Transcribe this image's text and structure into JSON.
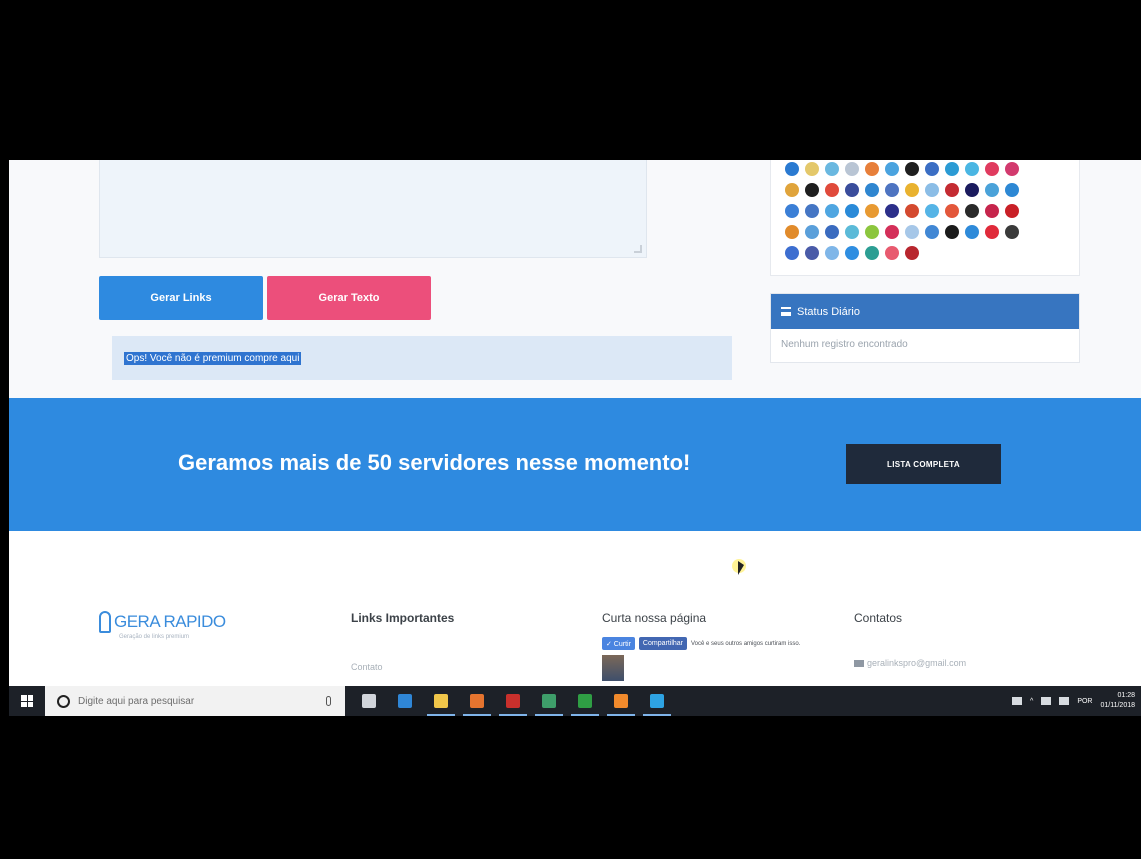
{
  "form": {
    "gerar_links_label": "Gerar Links",
    "gerar_texto_label": "Gerar Texto",
    "alert_text": "Ops! Você não é premium compre aqui"
  },
  "sidebar": {
    "status_title": "Status Diário",
    "status_empty": "Nenhum registro encontrado",
    "icon_rows": [
      [
        "#2a7ad1",
        "#e4c86a",
        "#6ab8e0",
        "#b9c5d4",
        "#e77f3a",
        "#4aa3df",
        "#1f1f1f",
        "#3b6ec4",
        "#2b9bd4",
        "#4ab6e3",
        "#e03b5f",
        "#d23a6e"
      ],
      [
        "#e0a43b",
        "#1f1f1f",
        "#e04a3b",
        "#3a4d9c",
        "#2f86d0",
        "#4e74c1",
        "#e9b22f",
        "#8bbde6",
        "#c42b32",
        "#1b1b5e",
        "#4aa2d9",
        "#2d88d4"
      ],
      [
        "#3b7fd6",
        "#4576c4",
        "#4fa6e1",
        "#2a8ad8",
        "#e89a32",
        "#2c2f8a",
        "#d44a2f",
        "#55b4e6",
        "#e3573b",
        "#2a2a2a",
        "#c6254c",
        "#c92027"
      ],
      [
        "#e18b2b",
        "#5a9fda",
        "#3a6bbf",
        "#5bbad8",
        "#8cc63e",
        "#d42f59",
        "#a6c7e8",
        "#4187d4",
        "#1b1b1b",
        "#2e8ad9",
        "#e02a3a",
        "#3a3a3a"
      ],
      [
        "#3d6ed0",
        "#4a5ba8",
        "#7fb6e8",
        "#2f8ee1",
        "#2c9e93",
        "#e85a6f",
        "#b8262e"
      ]
    ]
  },
  "banner": {
    "headline": "Geramos mais de 50 servidores nesse momento!",
    "button_label": "LISTA COMPLETA"
  },
  "footer": {
    "logo_text": "GERA RAPIDO",
    "logo_tagline": "Geração de links premium",
    "links_title": "Links Importantes",
    "contact_link": "Contato",
    "like_title": "Curta nossa página",
    "curtir_label": "✓ Curtir",
    "compartilhar_label": "Compartilhar",
    "fb_note": "Você e seus outros amigos curtiram isso.",
    "contact_title": "Contatos",
    "email": "geralinkspro@gmail.com"
  },
  "taskbar": {
    "search_placeholder": "Digite aqui para pesquisar",
    "apps": [
      {
        "name": "task-view",
        "color": "#d0d4da",
        "open": false
      },
      {
        "name": "edge",
        "color": "#2f86d6",
        "open": false
      },
      {
        "name": "file-explorer",
        "color": "#f0c64a",
        "open": true
      },
      {
        "name": "firefox",
        "color": "#e5742f",
        "open": true
      },
      {
        "name": "filezilla",
        "color": "#c9302c",
        "open": true
      },
      {
        "name": "app-green",
        "color": "#3e9e6a",
        "open": true
      },
      {
        "name": "terminal",
        "color": "#2f9e44",
        "open": true
      },
      {
        "name": "xampp",
        "color": "#f18a2c",
        "open": true
      },
      {
        "name": "skype",
        "color": "#2ea3e3",
        "open": true
      }
    ],
    "language": "POR",
    "time": "01:28",
    "date": "01/11/2018"
  }
}
